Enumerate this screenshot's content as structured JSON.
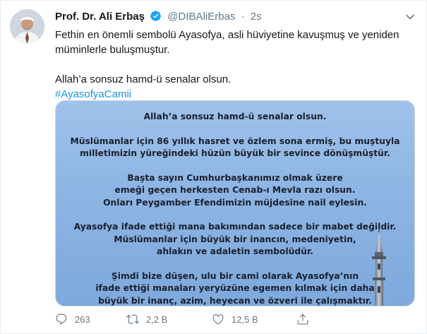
{
  "tweet": {
    "author_name": "Prof. Dr. Ali Erbaş",
    "handle": "@DIBAliErbas",
    "separator": "·",
    "time": "2s",
    "text_line1": "Fethin en önemli sembolü Ayasofya, asli hüviyetine kavuşmuş ve yeniden",
    "text_line2": "müminlerle buluşmuştur.",
    "text_line3": "Allah’a sonsuz hamd-ü senalar olsun.",
    "hashtag": "#AyasofyaCamii"
  },
  "image_text": {
    "p1": [
      "Allah’a sonsuz hamd-ü senalar olsun."
    ],
    "p2": [
      "Müslümanlar için 86 yıllık hasret ve özlem sona ermiş, bu muştuyla",
      "milletimizin yüreğindeki hüzün büyük bir sevince dönüşmüştür."
    ],
    "p3": [
      "Başta sayın Cumhurbaşkanımız olmak üzere",
      "emeği geçen herkesten Cenab-ı Mevla razı olsun.",
      "Onları Peygamber Efendimizin müjdesine nail eylesin."
    ],
    "p4": [
      "Ayasofya ifade ettiği mana bakımından sadece bir mabet değildir.",
      "Müslümanlar için büyük bir inancın, medeniyetin,",
      "ahlakın ve adaletin sembolüdür."
    ],
    "p5": [
      "Şimdi bize düşen, ulu bir cami olarak Ayasofya’nın",
      "ifade ettiği manaları yeryüzüne egemen kılmak için daha",
      "büyük bir inanç, azim, heyecan ve özveri ile çalışmaktır."
    ]
  },
  "actions": {
    "reply_count": "263",
    "retweet_count": "2,2 B",
    "like_count": "12,5 B"
  },
  "icons": {
    "verified": "verified-badge-icon",
    "caret": "chevron-down-icon",
    "reply": "reply-icon",
    "retweet": "retweet-icon",
    "like": "heart-icon",
    "share": "share-icon"
  },
  "colors": {
    "link": "#1b95e0",
    "muted": "#657786",
    "image_bg": "#8fb6e4"
  }
}
